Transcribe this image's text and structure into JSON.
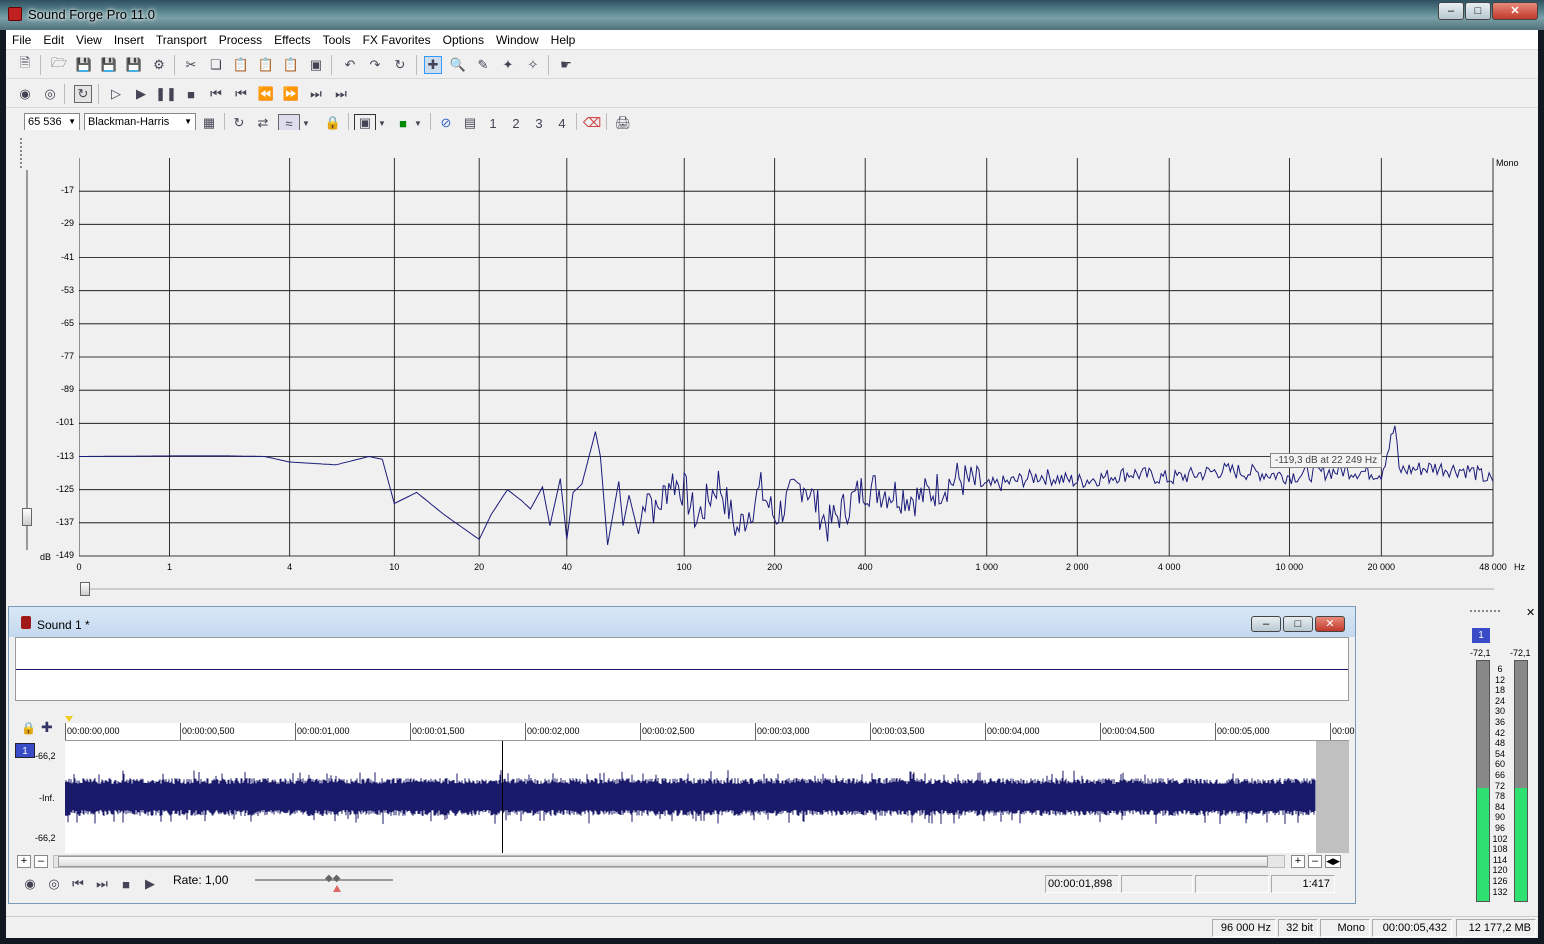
{
  "app": {
    "title": "Sound Forge Pro 11.0"
  },
  "menu": [
    "File",
    "Edit",
    "View",
    "Insert",
    "Transport",
    "Process",
    "Effects",
    "Tools",
    "FX Favorites",
    "Options",
    "Window",
    "Help"
  ],
  "spectrum_toolbar": {
    "fft_size": "65 536",
    "window": "Blackman-Harris",
    "snap_1": "1",
    "snap_2": "2",
    "snap_3": "3",
    "snap_4": "4"
  },
  "chart_data": {
    "type": "line",
    "series_label": "Mono",
    "xlabel": "Hz",
    "ylabel": "dB",
    "x_scale": "log",
    "x_ticks": [
      "0",
      "1",
      "4",
      "10",
      "20",
      "40",
      "100",
      "200",
      "400",
      "1 000",
      "2 000",
      "4 000",
      "10 000",
      "20 000",
      "48 000"
    ],
    "y_ticks": [
      "-17",
      "-29",
      "-41",
      "-53",
      "-65",
      "-77",
      "-89",
      "-101",
      "-113",
      "-125",
      "-137",
      "-149"
    ],
    "ylim": [
      -149,
      -5
    ],
    "grid": true,
    "tooltip": "-119,3 dB at 22 249 Hz",
    "points": [
      [
        0,
        -113
      ],
      [
        1,
        -112.8
      ],
      [
        2,
        -112.8
      ],
      [
        3,
        -113
      ],
      [
        4,
        -115
      ],
      [
        6,
        -116
      ],
      [
        8,
        -113
      ],
      [
        9,
        -114
      ],
      [
        10,
        -130
      ],
      [
        12,
        -126
      ],
      [
        15,
        -134
      ],
      [
        20,
        -143
      ],
      [
        22,
        -134
      ],
      [
        25,
        -125
      ],
      [
        28,
        -129
      ],
      [
        30,
        -132
      ],
      [
        33,
        -124
      ],
      [
        35,
        -138
      ],
      [
        38,
        -121
      ],
      [
        40,
        -143
      ],
      [
        42,
        -126
      ],
      [
        45,
        -123
      ],
      [
        50,
        -104
      ],
      [
        52,
        -113
      ],
      [
        55,
        -145
      ],
      [
        60,
        -122
      ],
      [
        62,
        -138
      ],
      [
        65,
        -127
      ],
      [
        70,
        -141
      ],
      [
        75,
        -123
      ],
      [
        80,
        -134
      ],
      [
        90,
        -121
      ],
      [
        100,
        -125
      ],
      [
        110,
        -136
      ],
      [
        130,
        -122
      ],
      [
        150,
        -140
      ],
      [
        180,
        -125
      ],
      [
        200,
        -135
      ],
      [
        250,
        -122
      ],
      [
        300,
        -138
      ],
      [
        400,
        -124
      ],
      [
        600,
        -128
      ],
      [
        800,
        -121
      ],
      [
        1000,
        -124
      ],
      [
        1500,
        -120
      ],
      [
        2000,
        -122
      ],
      [
        3000,
        -119
      ],
      [
        4000,
        -121
      ],
      [
        6000,
        -118
      ],
      [
        8000,
        -119
      ],
      [
        10000,
        -120
      ],
      [
        15000,
        -118
      ],
      [
        20000,
        -119
      ],
      [
        22249,
        -102
      ],
      [
        23000,
        -118
      ],
      [
        30000,
        -117
      ],
      [
        40000,
        -118
      ],
      [
        48000,
        -122
      ]
    ]
  },
  "sound_window": {
    "title": "Sound 1 *",
    "timeline": [
      "00:00:00,000",
      "00:00:00,500",
      "00:00:01,000",
      "00:00:01,500",
      "00:00:02,000",
      "00:00:02,500",
      "00:00:03,000",
      "00:00:03,500",
      "00:00:04,000",
      "00:00:04,500",
      "00:00:05,000",
      "00:00"
    ],
    "channel": "1",
    "db_top": "-66,2",
    "db_mid": "-Inf.",
    "db_bottom": "-66,2",
    "rate_label": "Rate: 1,00",
    "cursor_time": "00:00:01,898",
    "zoom": "1:417"
  },
  "meter": {
    "channel": "1",
    "left_peak": "-72,1",
    "right_peak": "-72,1",
    "scale": [
      "6",
      "12",
      "18",
      "24",
      "30",
      "36",
      "42",
      "48",
      "54",
      "60",
      "66",
      "72",
      "78",
      "84",
      "90",
      "96",
      "102",
      "108",
      "114",
      "120",
      "126",
      "132"
    ],
    "level_fraction": 0.47
  },
  "status": {
    "sample_rate": "96 000 Hz",
    "bit_depth": "32 bit",
    "channels": "Mono",
    "length": "00:00:05,432",
    "free_space": "12 177,2 MB"
  }
}
